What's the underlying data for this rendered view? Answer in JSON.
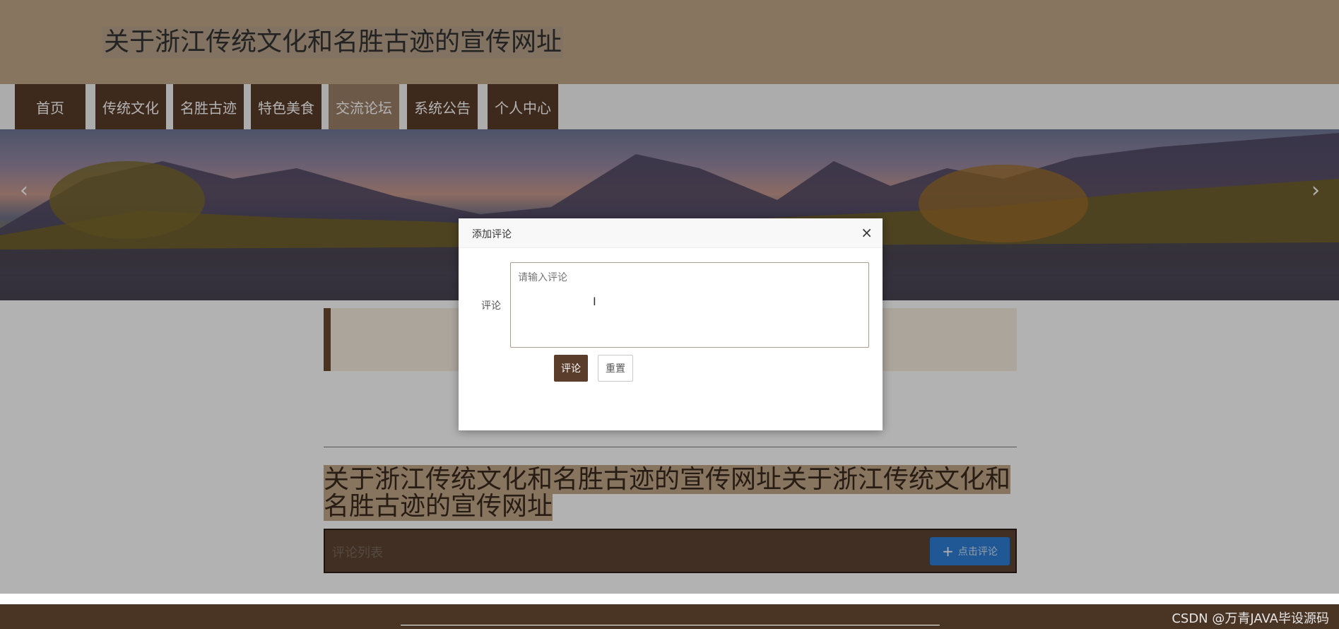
{
  "header": {
    "site_title": "关于浙江传统文化和名胜古迹的宣传网址"
  },
  "nav": {
    "items": [
      {
        "label": "首页"
      },
      {
        "label": "传统文化"
      },
      {
        "label": "名胜古迹"
      },
      {
        "label": "特色美食"
      },
      {
        "label": "交流论坛",
        "active": true
      },
      {
        "label": "系统公告"
      },
      {
        "label": "个人中心"
      }
    ]
  },
  "banner": {
    "prev_icon": "chevron-left-icon",
    "next_icon": "chevron-right-icon",
    "prev_symbol": "‹",
    "next_symbol": "›"
  },
  "article": {
    "title": "关于浙江传统文化和名胜古迹的宣传网址关于浙江传统文化和名胜古迹的宣传网址"
  },
  "comments": {
    "list_label": "评论列表",
    "add_button_label": "点击评论",
    "add_icon": "plus-icon",
    "plus_symbol": "+"
  },
  "modal": {
    "title": "添加评论",
    "close_symbol": "×",
    "field_label": "评论",
    "placeholder": "请输入评论",
    "submit_label": "评论",
    "reset_label": "重置"
  },
  "footer": {
    "watermark": "CSDN @万青JAVA毕设源码"
  },
  "colors": {
    "header_bg": "#c3a88a",
    "nav_bg": "#5a3d2a",
    "nav_active_bg": "#9c8068",
    "accent_blue": "#2e7dd6",
    "footer_bg": "#4a3424"
  }
}
